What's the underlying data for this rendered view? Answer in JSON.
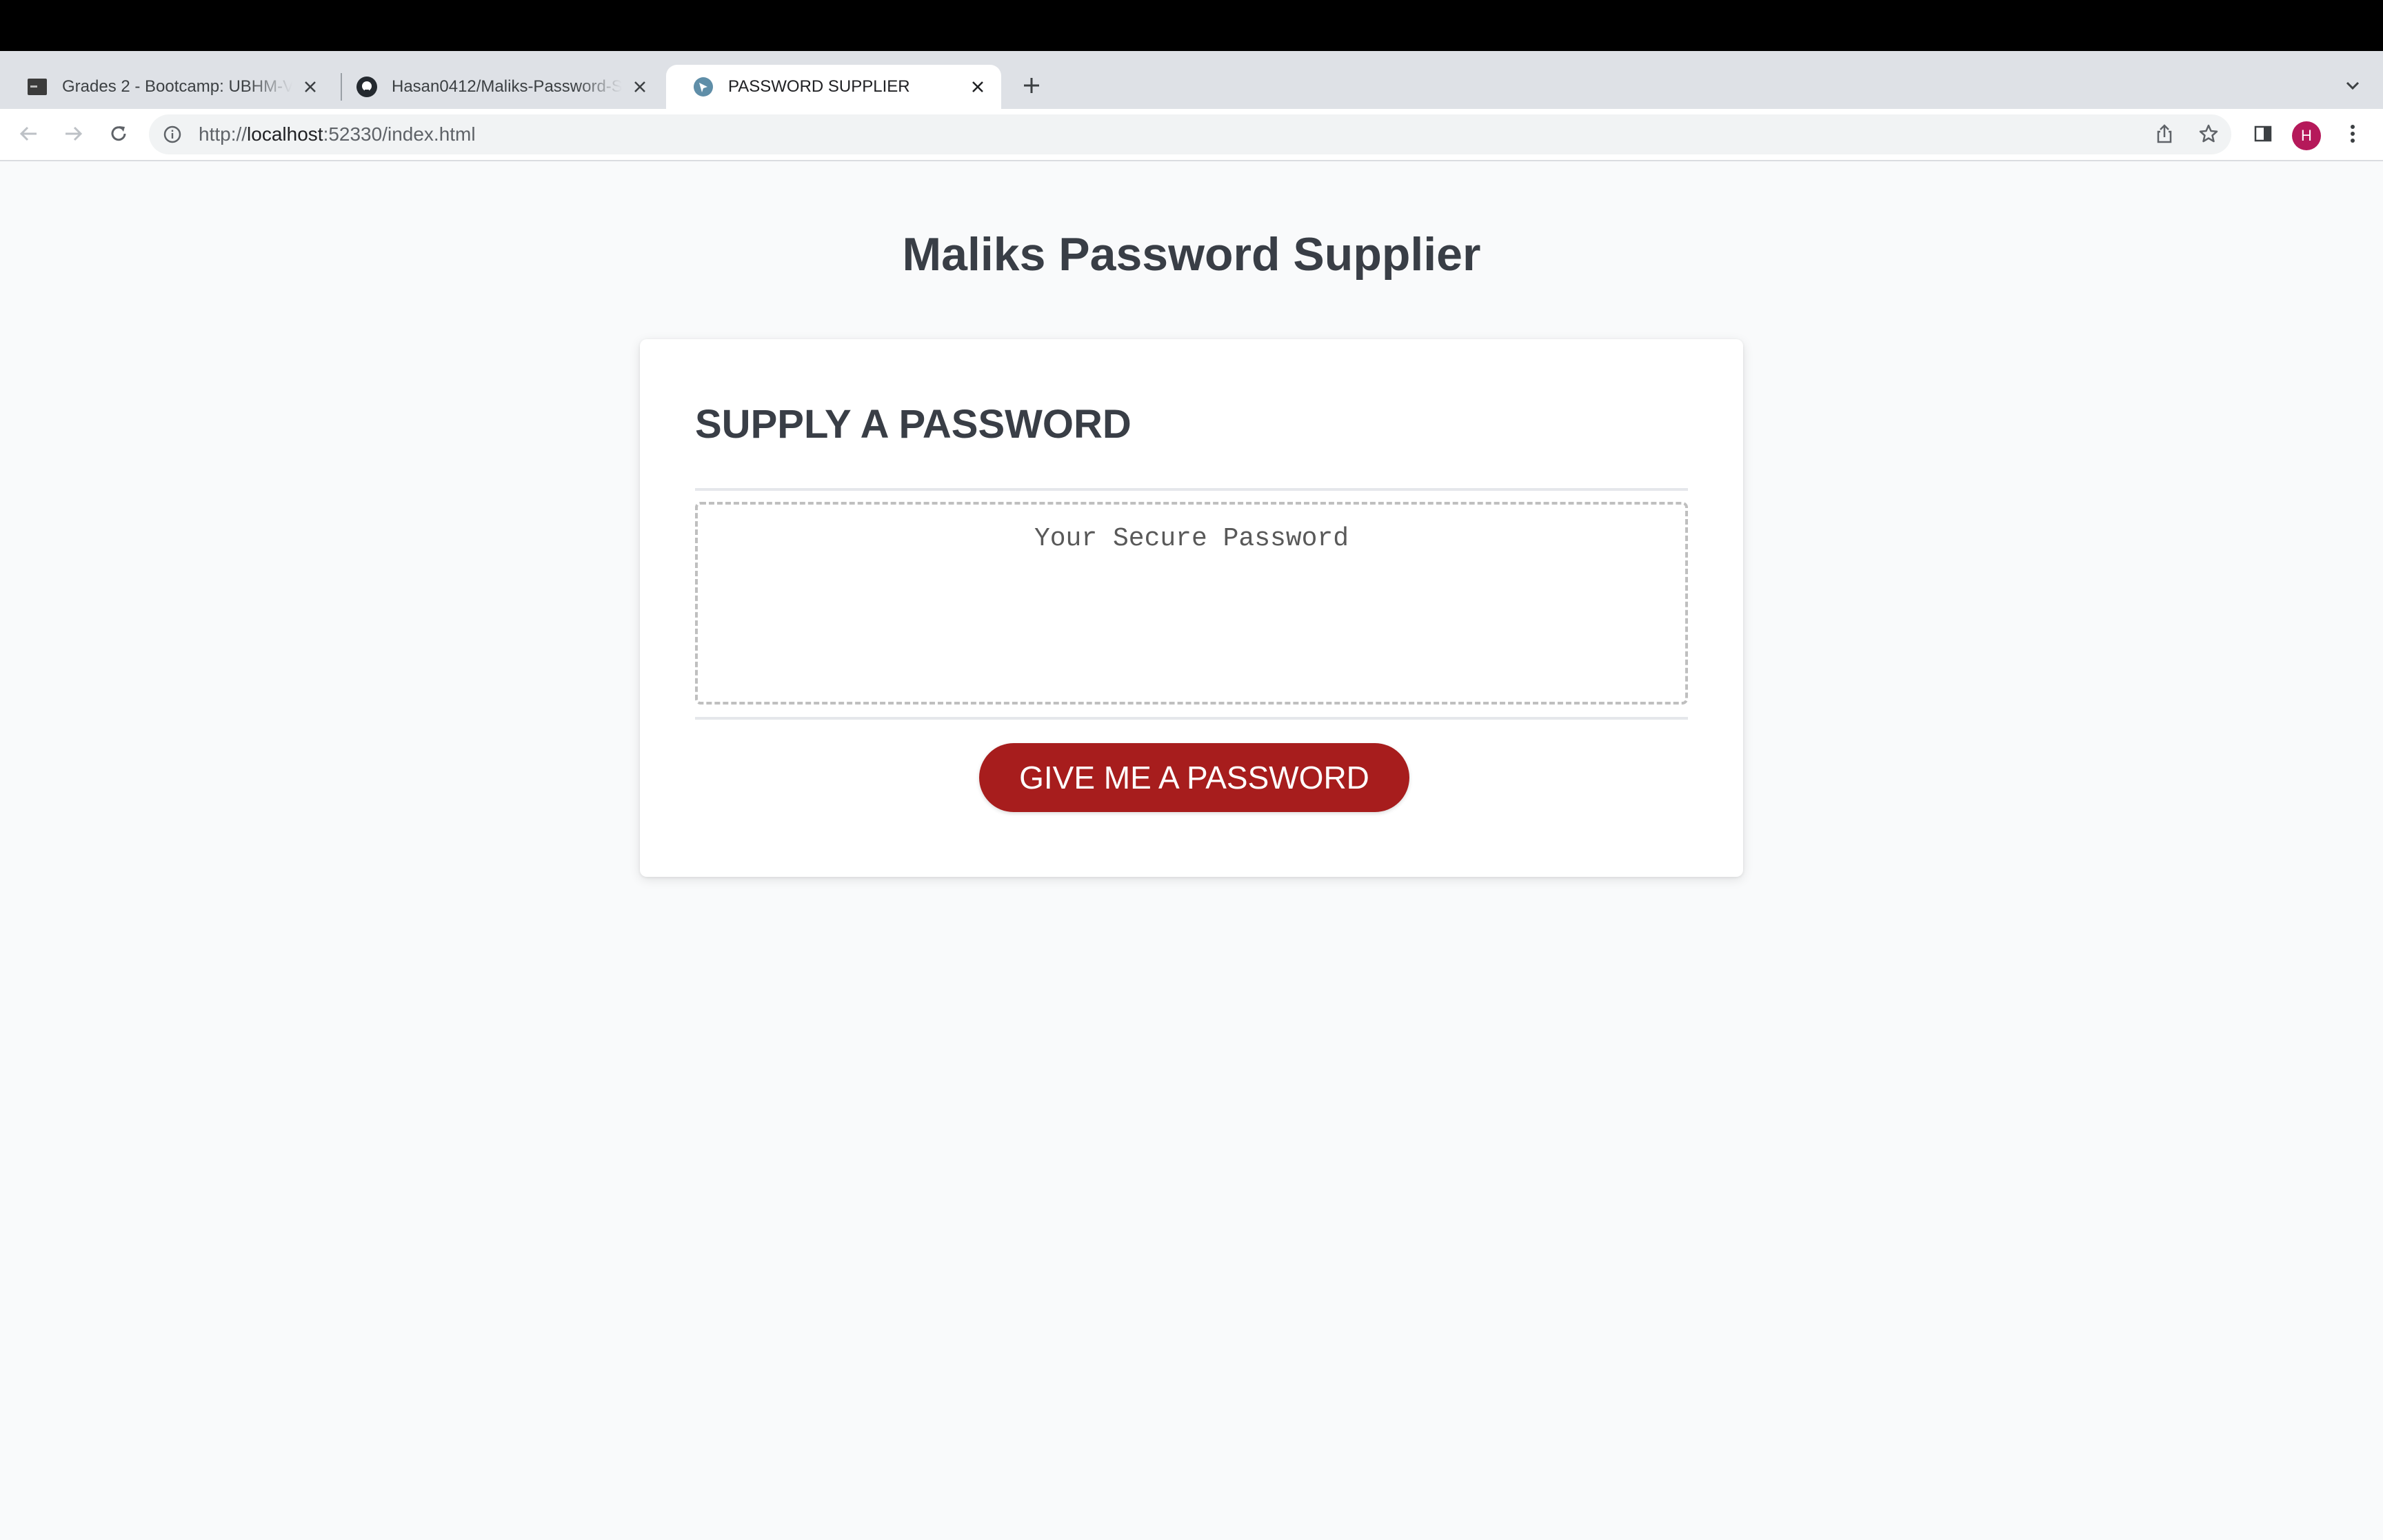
{
  "browser": {
    "tabs": [
      {
        "title": "Grades 2 - Bootcamp: UBHM-V",
        "active": false
      },
      {
        "title": "Hasan0412/Maliks-Password-S",
        "active": false
      },
      {
        "title": "PASSWORD SUPPLIER",
        "active": true
      }
    ],
    "url": {
      "scheme": "http://",
      "host": "localhost",
      "rest": ":52330/index.html"
    },
    "profile_initial": "H"
  },
  "page": {
    "title": "Maliks Password Supplier",
    "card": {
      "header": "SUPPLY A PASSWORD",
      "password_placeholder": "Your Secure Password",
      "password_value": "",
      "generate_button": "GIVE ME A PASSWORD"
    }
  },
  "colors": {
    "accent_button": "#a71d1d",
    "heading_text": "#393e46",
    "page_background": "#f9fafb"
  }
}
